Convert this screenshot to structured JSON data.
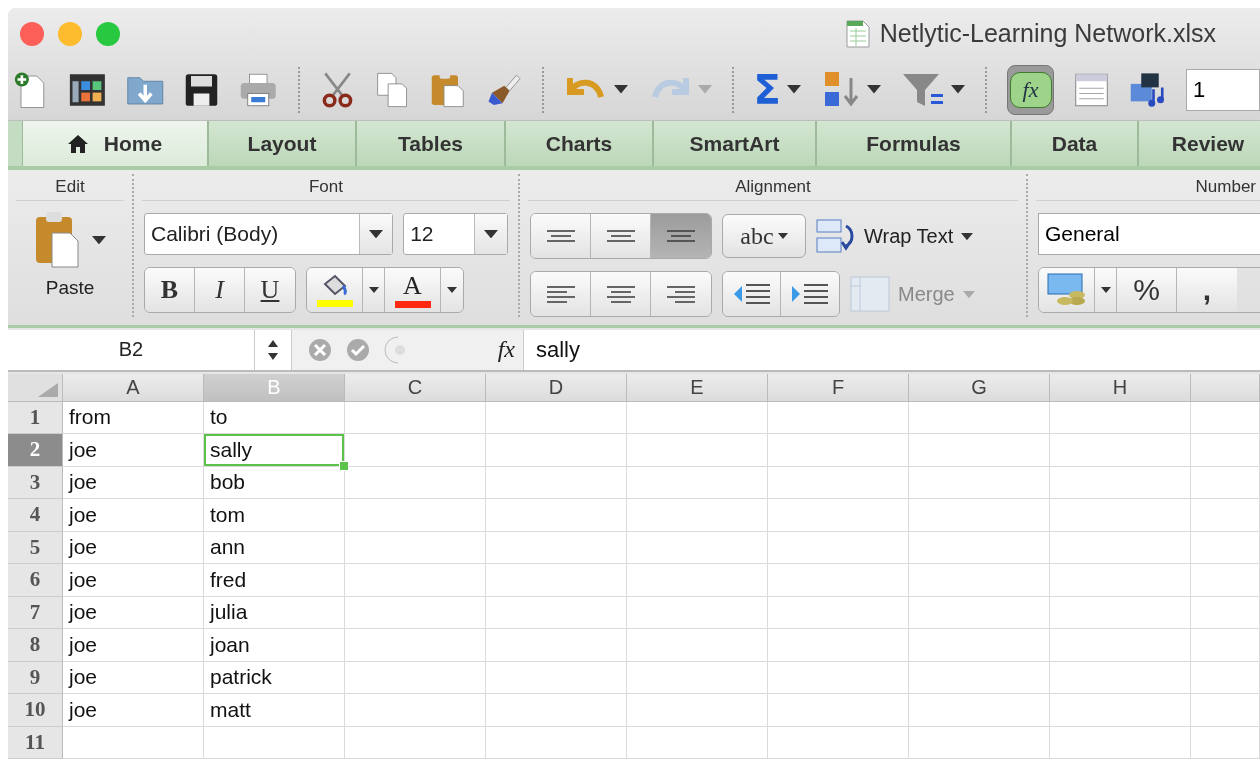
{
  "window": {
    "title": "Netlytic-Learning Network.xlsx"
  },
  "toolbar": {
    "autosum": "Σ",
    "formula_builder": {
      "label": "fx",
      "on": true
    },
    "redo_disabled": true,
    "zoom_field": "1"
  },
  "tabs": [
    {
      "label": "Home",
      "selected": true
    },
    {
      "label": "Layout",
      "selected": false
    },
    {
      "label": "Tables",
      "selected": false
    },
    {
      "label": "Charts",
      "selected": false
    },
    {
      "label": "SmartArt",
      "selected": false
    },
    {
      "label": "Formulas",
      "selected": false
    },
    {
      "label": "Data",
      "selected": false
    },
    {
      "label": "Review",
      "selected": false
    }
  ],
  "ribbon": {
    "edit": {
      "title": "Edit",
      "paste": "Paste"
    },
    "font": {
      "title": "Font",
      "family": "Calibri (Body)",
      "size": "12",
      "styles": [
        "B",
        "I",
        "U"
      ],
      "font_letter": "A"
    },
    "alignment": {
      "title": "Alignment",
      "vertical": [
        {
          "selected": false
        },
        {
          "selected": false
        },
        {
          "selected": true
        }
      ],
      "orientation": "abc",
      "wrap": "Wrap Text",
      "merge": "Merge",
      "merge_disabled": true
    },
    "number": {
      "title": "Number",
      "format": "General",
      "buttons": [
        "%",
        ","
      ]
    }
  },
  "formula_bar": {
    "name_box": "B2",
    "fx": "fx",
    "value": "sally"
  },
  "sheet": {
    "columns": [
      {
        "label": "A",
        "selected": false
      },
      {
        "label": "B",
        "selected": true
      },
      {
        "label": "C",
        "selected": false
      },
      {
        "label": "D",
        "selected": false
      },
      {
        "label": "E",
        "selected": false
      },
      {
        "label": "F",
        "selected": false
      },
      {
        "label": "G",
        "selected": false
      },
      {
        "label": "H",
        "selected": false
      }
    ],
    "rows": [
      {
        "label": "1",
        "selected": false,
        "cells": [
          {
            "text": "from",
            "selected": false
          },
          {
            "text": "to",
            "selected": false
          }
        ]
      },
      {
        "label": "2",
        "selected": true,
        "cells": [
          {
            "text": "joe",
            "selected": false
          },
          {
            "text": "sally",
            "selected": true
          }
        ]
      },
      {
        "label": "3",
        "selected": false,
        "cells": [
          {
            "text": "joe",
            "selected": false
          },
          {
            "text": "bob",
            "selected": false
          }
        ]
      },
      {
        "label": "4",
        "selected": false,
        "cells": [
          {
            "text": "joe",
            "selected": false
          },
          {
            "text": "tom",
            "selected": false
          }
        ]
      },
      {
        "label": "5",
        "selected": false,
        "cells": [
          {
            "text": "joe",
            "selected": false
          },
          {
            "text": "ann",
            "selected": false
          }
        ]
      },
      {
        "label": "6",
        "selected": false,
        "cells": [
          {
            "text": "joe",
            "selected": false
          },
          {
            "text": "fred",
            "selected": false
          }
        ]
      },
      {
        "label": "7",
        "selected": false,
        "cells": [
          {
            "text": "joe",
            "selected": false
          },
          {
            "text": "julia",
            "selected": false
          }
        ]
      },
      {
        "label": "8",
        "selected": false,
        "cells": [
          {
            "text": "joe",
            "selected": false
          },
          {
            "text": "joan",
            "selected": false
          }
        ]
      },
      {
        "label": "9",
        "selected": false,
        "cells": [
          {
            "text": "joe",
            "selected": false
          },
          {
            "text": "patrick",
            "selected": false
          }
        ]
      },
      {
        "label": "10",
        "selected": false,
        "cells": [
          {
            "text": "joe",
            "selected": false
          },
          {
            "text": "matt",
            "selected": false
          }
        ]
      },
      {
        "label": "11",
        "selected": false,
        "cells": []
      }
    ]
  }
}
